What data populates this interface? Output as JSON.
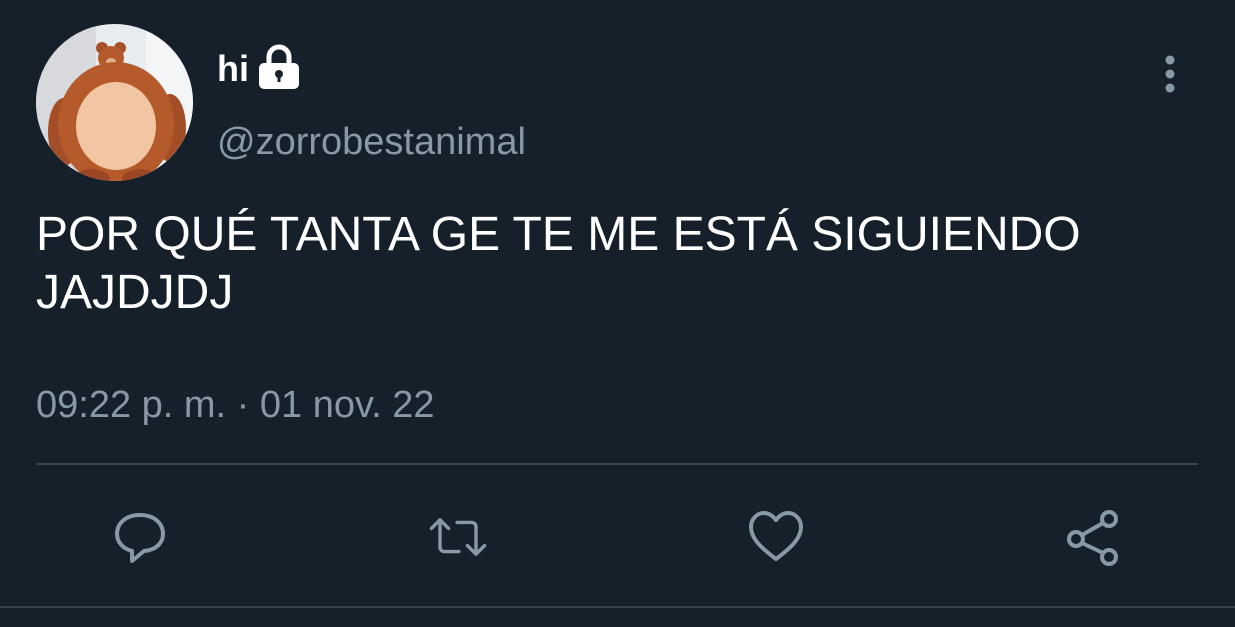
{
  "user": {
    "display_name": "hi",
    "handle": "@zorrobestanimal",
    "avatar": "teddy-bear-photo",
    "protected_icon": "lock-icon"
  },
  "tweet": {
    "text": "POR QUÉ TANTA GE TE ME ESTÁ SIGUIENDO JAJDJDJ",
    "timestamp": "09:22 p. m. · 01 nov. 22"
  },
  "actions": [
    {
      "icon": "reply-icon"
    },
    {
      "icon": "retweet-icon"
    },
    {
      "icon": "like-icon"
    },
    {
      "icon": "share-icon"
    }
  ],
  "menu": {
    "icon": "more-vertical-icon"
  },
  "colors": {
    "background": "#15202b",
    "primary_text": "#ffffff",
    "secondary_text": "#8899a6",
    "divider": "#38444d"
  }
}
